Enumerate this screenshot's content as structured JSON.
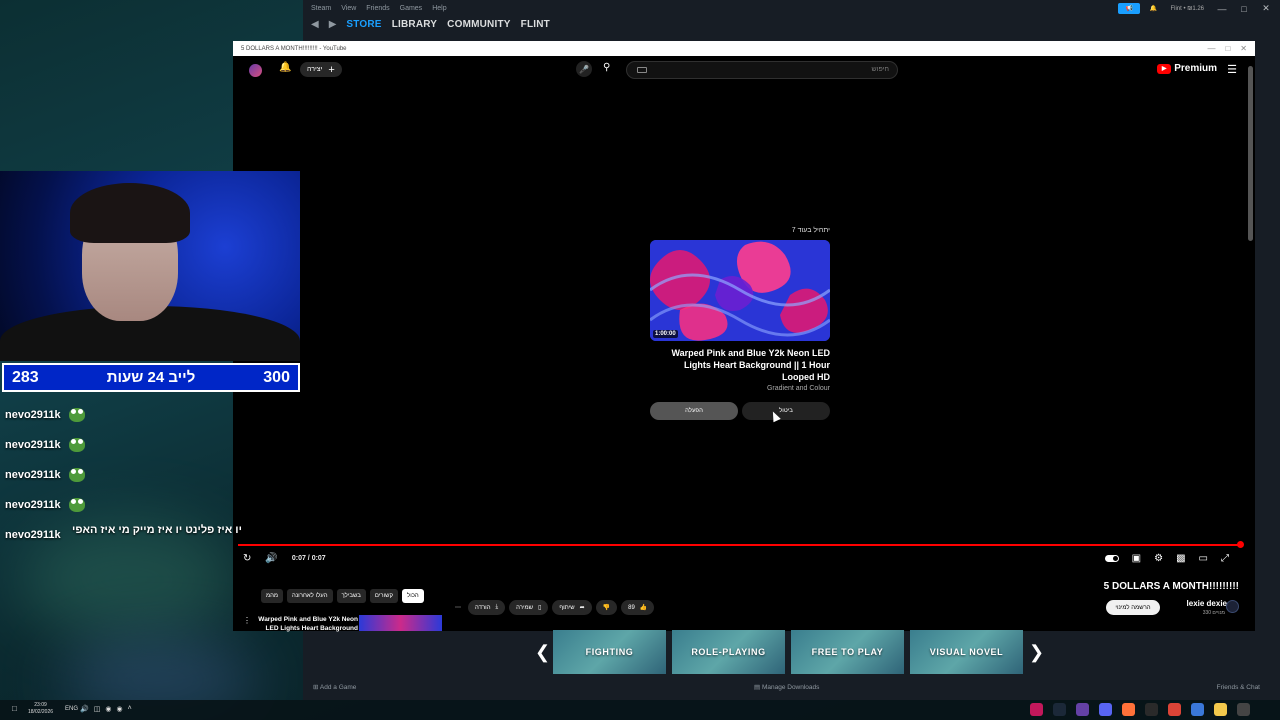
{
  "steam": {
    "menu": [
      "Steam",
      "View",
      "Friends",
      "Games",
      "Help"
    ],
    "nav": [
      "STORE",
      "LIBRARY",
      "COMMUNITY",
      "FLINT"
    ],
    "active_nav": "STORE",
    "user": "Flint • ₪1.26",
    "carousel": [
      "FIGHTING",
      "ROLE-PLAYING",
      "FREE TO PLAY",
      "VISUAL NOVEL"
    ],
    "footer": {
      "add_game": "Add a Game",
      "downloads": "Manage Downloads",
      "friends": "Friends & Chat"
    }
  },
  "youtube": {
    "window_title": "5 DOLLARS A MONTH!!!!!!!!! - YouTube",
    "brand": "Premium",
    "create_label": "יצירה",
    "search_placeholder": "חיפוש",
    "upnext": {
      "label": "יתחיל בעוד 7",
      "duration": "1:00:00",
      "title": "Warped Pink and Blue Y2k Neon LED Lights Heart Background || 1 Hour Looped HD",
      "channel": "Gradient and Colour",
      "play_label": "הפעלה",
      "cancel_label": "ביטול"
    },
    "progress": 1.0,
    "time": "0:07 / 0:07",
    "chips": [
      "מהמ",
      "העלו לאחרונה",
      "בשבילך",
      "קשורים",
      "הכול"
    ],
    "actions": {
      "download": "הורדה",
      "save": "שמירה",
      "share": "שיתוף",
      "likes": "89"
    },
    "video_title": "5 DOLLARS A MONTH!!!!!!!!!",
    "channel_name": "lexie dexie",
    "channel_subs": "330 מנויים",
    "subscribe_label": "הרשמה למינוי",
    "mini_title": "Warped Pink and Blue Y2k Neon LED Lights Heart Background"
  },
  "stream": {
    "left_num": "283",
    "label": "לייב 24 שעות",
    "right_num": "300",
    "chat": [
      {
        "user": "nevo2911k"
      },
      {
        "user": "nevo2911k"
      },
      {
        "user": "nevo2911k"
      },
      {
        "user": "nevo2911k"
      },
      {
        "user": "nevo2911k"
      }
    ],
    "last_message": "יו איז פלינט יו איז מייק מי איז האפי"
  },
  "taskbar": {
    "time": "23:09",
    "date": "18/02/2026",
    "lang": "ENG"
  },
  "colors": {
    "accent": "#ff0000",
    "steam_blue": "#1a9fff",
    "stat_bg": "#0026c7"
  }
}
